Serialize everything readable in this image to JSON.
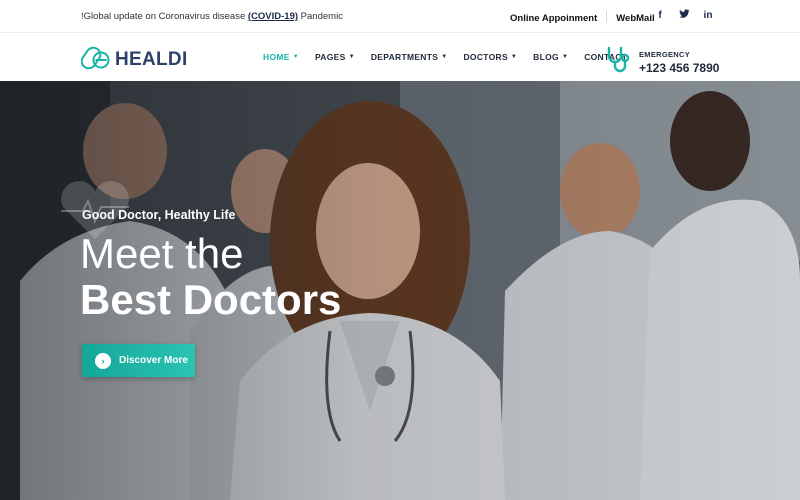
{
  "topbar": {
    "notice_prefix": "!Global update on Coronavirus disease ",
    "notice_highlight": "(COVID-19)",
    "notice_suffix": " Pandemic",
    "online_appointment": "Online Appoinment",
    "webmail": "WebMail",
    "social": [
      {
        "icon": "facebook-icon",
        "glyph": "f"
      },
      {
        "icon": "twitter-icon",
        "glyph": "🐦"
      },
      {
        "icon": "linkedin-icon",
        "glyph": "in"
      }
    ]
  },
  "header": {
    "logo_text": "HEALDI",
    "nav": [
      {
        "label": "HOME",
        "caret": true,
        "active": true
      },
      {
        "label": "PAGES",
        "caret": true,
        "active": false
      },
      {
        "label": "DEPARTMENTS",
        "caret": true,
        "active": false
      },
      {
        "label": "DOCTORS",
        "caret": true,
        "active": false
      },
      {
        "label": "BLOG",
        "caret": true,
        "active": false
      },
      {
        "label": "CONTACT",
        "caret": false,
        "active": false
      }
    ],
    "emergency_label": "EMERGENCY",
    "emergency_phone": "+123 456 7890"
  },
  "hero": {
    "tagline": "Good Doctor, Healthy Life",
    "heading_light": "Meet the",
    "heading_bold": "Best Doctors",
    "cta_label": "Discover More"
  },
  "colors": {
    "accent": "#19b4a6",
    "brand_dark": "#2e4168",
    "cta_start": "#13a79a",
    "cta_end": "#2cc3b3"
  }
}
